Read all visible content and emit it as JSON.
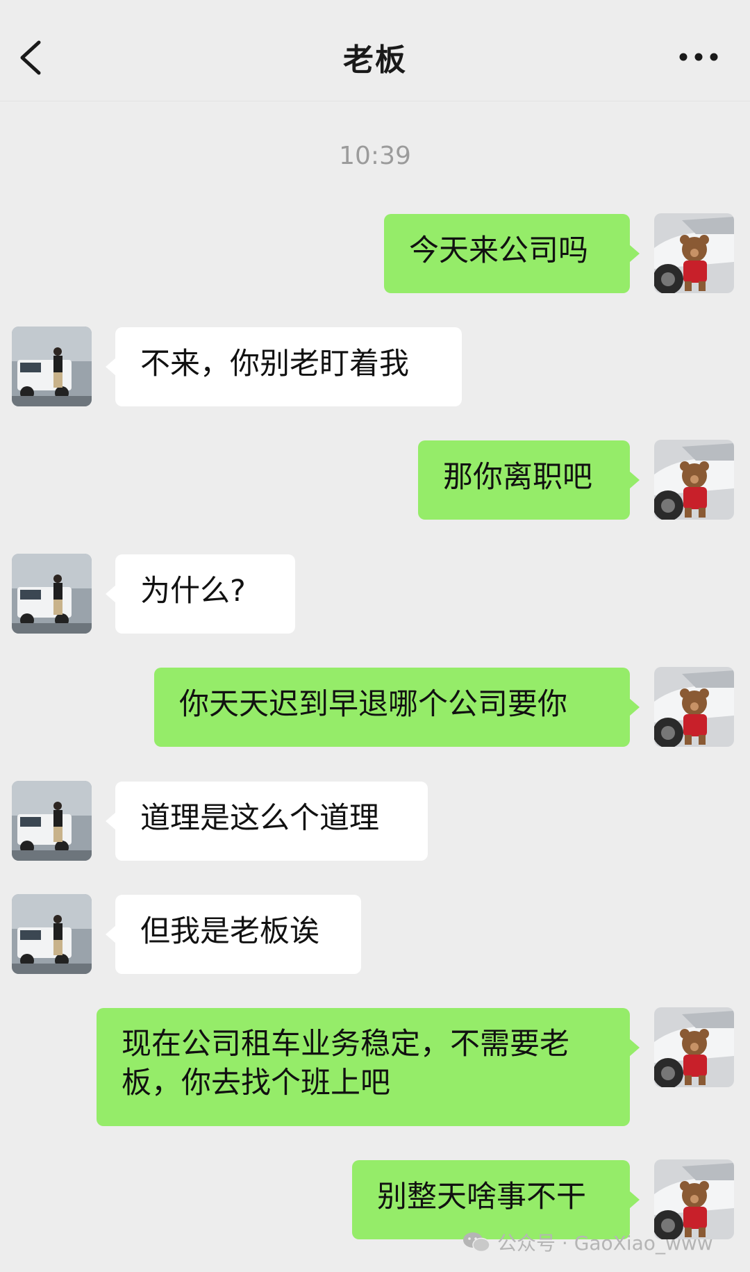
{
  "header": {
    "title": "老板"
  },
  "timestamp": "10:39",
  "messages": [
    {
      "from": "me",
      "text": "今天来公司吗"
    },
    {
      "from": "them",
      "text": "不来，你别老盯着我"
    },
    {
      "from": "me",
      "text": "那你离职吧"
    },
    {
      "from": "them",
      "text": "为什么?"
    },
    {
      "from": "me",
      "text": "你天天迟到早退哪个公司要你"
    },
    {
      "from": "them",
      "text": "道理是这么个道理"
    },
    {
      "from": "them",
      "text": "但我是老板诶"
    },
    {
      "from": "me",
      "text": "现在公司租车业务稳定，不需要老板，你去找个班上吧"
    },
    {
      "from": "me",
      "text": "别整天啥事不干"
    }
  ],
  "watermark": {
    "text": "公众号 · GaoXiao_www"
  },
  "colors": {
    "background": "#ededed",
    "my_bubble": "#95ec69",
    "their_bubble": "#ffffff",
    "timestamp": "#9b9b9b"
  }
}
